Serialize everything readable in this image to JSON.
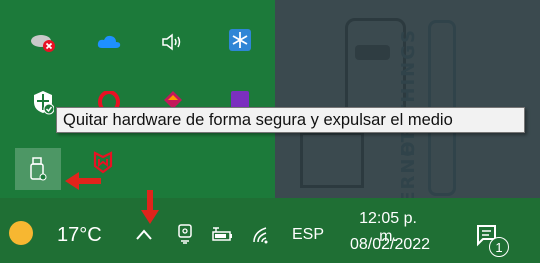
{
  "tooltip": {
    "text": "Quitar hardware de forma segura y expulsar el medio"
  },
  "tray_icons": [
    {
      "name": "cloud-error-icon"
    },
    {
      "name": "onedrive-icon"
    },
    {
      "name": "volume-icon"
    },
    {
      "name": "bluetooth-snowflake-icon"
    },
    {
      "name": "windows-security-icon"
    },
    {
      "name": "opera-icon"
    },
    {
      "name": "colorful-app-icon"
    },
    {
      "name": "purple-app-icon"
    },
    {
      "name": "usb-safely-remove-icon"
    },
    {
      "name": "mcafee-icon"
    }
  ],
  "taskbar": {
    "temperature": "17°C",
    "language": "ESP",
    "time": "12:05 p. m.",
    "date": "08/02/2022",
    "notification_count": "1"
  },
  "colors": {
    "flyout_bg": "#1c7a3a",
    "taskbar_bg": "#1f6f34",
    "arrow_red": "#e0241b"
  }
}
